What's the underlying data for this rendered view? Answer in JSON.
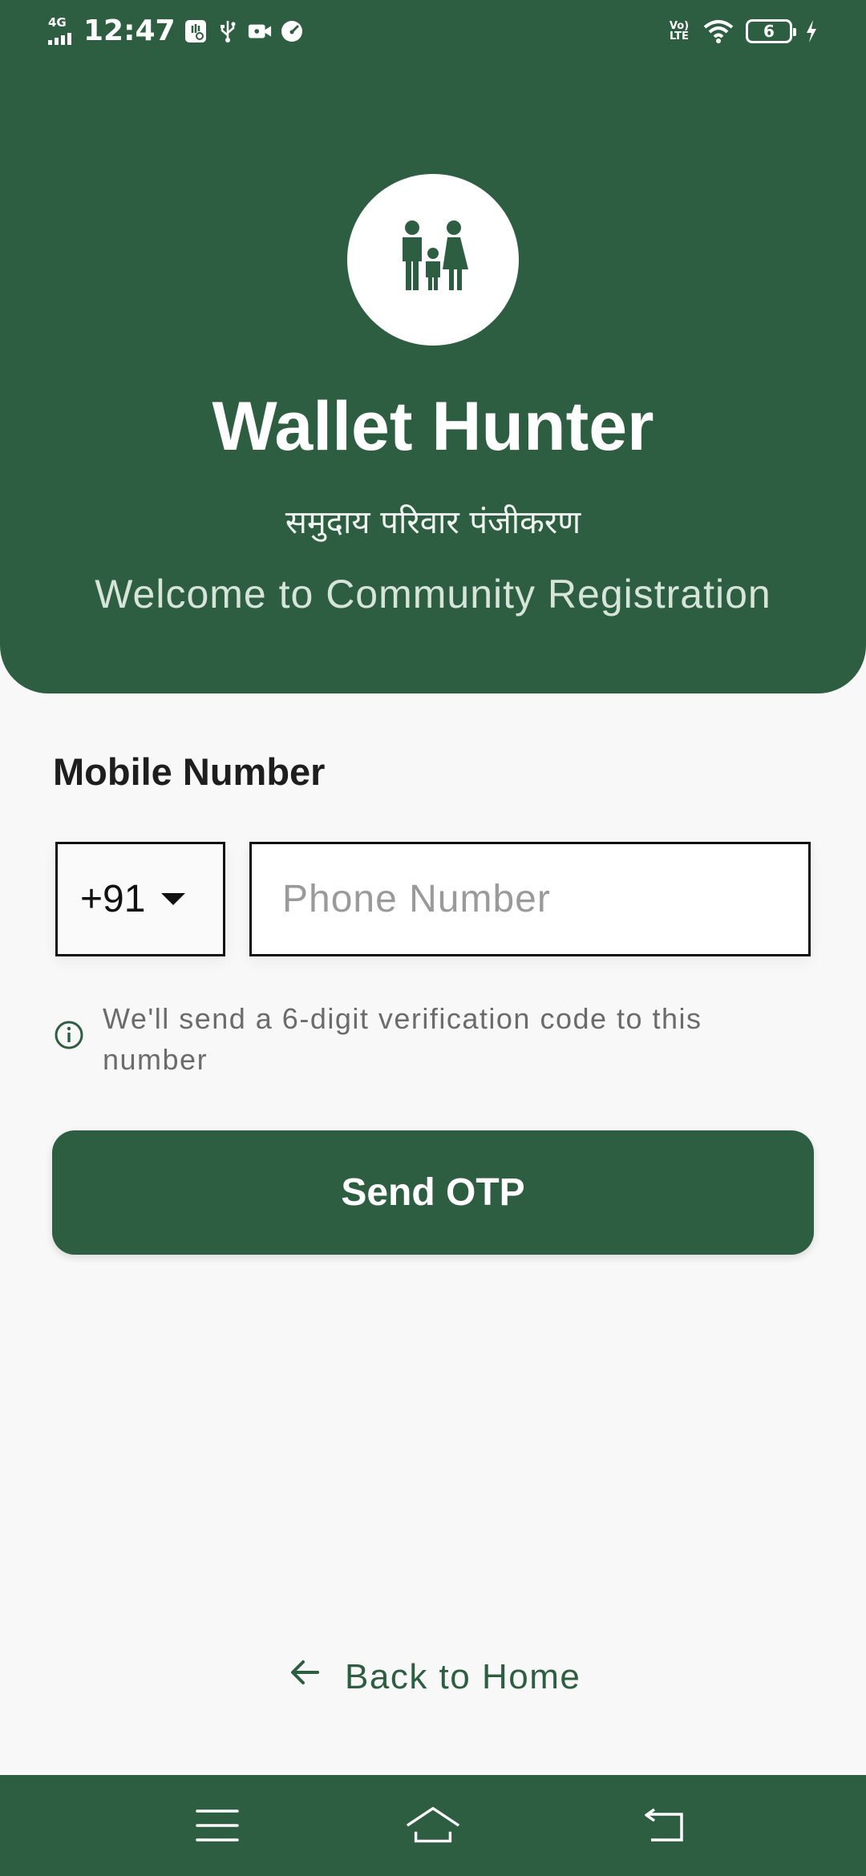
{
  "status_bar": {
    "network": "4G",
    "time": "12:47",
    "volte": "Vo) LTE",
    "battery": "6"
  },
  "header": {
    "logo_icon": "family-icon",
    "title": "Wallet Hunter",
    "subtitle_hindi": "समुदाय परिवार पंजीकरण",
    "subtitle_english": "Welcome to Community Registration"
  },
  "form": {
    "label": "Mobile Number",
    "country_code": "+91",
    "phone_placeholder": "Phone Number",
    "phone_value": "",
    "info_text": "We'll send a 6-digit verification code to this number",
    "submit_label": "Send OTP"
  },
  "footer": {
    "back_label": "Back to Home"
  },
  "nav_bar": {
    "icons": [
      "menu-icon",
      "home-icon",
      "back-icon"
    ]
  },
  "colors": {
    "primary": "#2e5e42",
    "background": "#f8f8f8",
    "text_dark": "#1e1e1e",
    "text_muted": "#6b6b6b"
  }
}
